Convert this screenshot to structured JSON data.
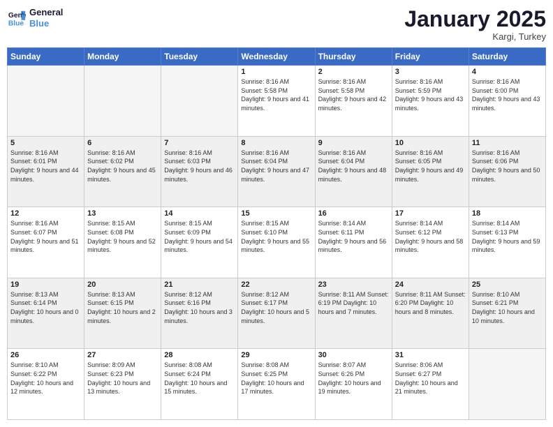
{
  "header": {
    "logo_line1": "General",
    "logo_line2": "Blue",
    "month": "January 2025",
    "location": "Kargi, Turkey"
  },
  "days_of_week": [
    "Sunday",
    "Monday",
    "Tuesday",
    "Wednesday",
    "Thursday",
    "Friday",
    "Saturday"
  ],
  "weeks": [
    [
      {
        "day": "",
        "text": ""
      },
      {
        "day": "",
        "text": ""
      },
      {
        "day": "",
        "text": ""
      },
      {
        "day": "1",
        "text": "Sunrise: 8:16 AM\nSunset: 5:58 PM\nDaylight: 9 hours\nand 41 minutes."
      },
      {
        "day": "2",
        "text": "Sunrise: 8:16 AM\nSunset: 5:58 PM\nDaylight: 9 hours\nand 42 minutes."
      },
      {
        "day": "3",
        "text": "Sunrise: 8:16 AM\nSunset: 5:59 PM\nDaylight: 9 hours\nand 43 minutes."
      },
      {
        "day": "4",
        "text": "Sunrise: 8:16 AM\nSunset: 6:00 PM\nDaylight: 9 hours\nand 43 minutes."
      }
    ],
    [
      {
        "day": "5",
        "text": "Sunrise: 8:16 AM\nSunset: 6:01 PM\nDaylight: 9 hours\nand 44 minutes."
      },
      {
        "day": "6",
        "text": "Sunrise: 8:16 AM\nSunset: 6:02 PM\nDaylight: 9 hours\nand 45 minutes."
      },
      {
        "day": "7",
        "text": "Sunrise: 8:16 AM\nSunset: 6:03 PM\nDaylight: 9 hours\nand 46 minutes."
      },
      {
        "day": "8",
        "text": "Sunrise: 8:16 AM\nSunset: 6:04 PM\nDaylight: 9 hours\nand 47 minutes."
      },
      {
        "day": "9",
        "text": "Sunrise: 8:16 AM\nSunset: 6:04 PM\nDaylight: 9 hours\nand 48 minutes."
      },
      {
        "day": "10",
        "text": "Sunrise: 8:16 AM\nSunset: 6:05 PM\nDaylight: 9 hours\nand 49 minutes."
      },
      {
        "day": "11",
        "text": "Sunrise: 8:16 AM\nSunset: 6:06 PM\nDaylight: 9 hours\nand 50 minutes."
      }
    ],
    [
      {
        "day": "12",
        "text": "Sunrise: 8:16 AM\nSunset: 6:07 PM\nDaylight: 9 hours\nand 51 minutes."
      },
      {
        "day": "13",
        "text": "Sunrise: 8:15 AM\nSunset: 6:08 PM\nDaylight: 9 hours\nand 52 minutes."
      },
      {
        "day": "14",
        "text": "Sunrise: 8:15 AM\nSunset: 6:09 PM\nDaylight: 9 hours\nand 54 minutes."
      },
      {
        "day": "15",
        "text": "Sunrise: 8:15 AM\nSunset: 6:10 PM\nDaylight: 9 hours\nand 55 minutes."
      },
      {
        "day": "16",
        "text": "Sunrise: 8:14 AM\nSunset: 6:11 PM\nDaylight: 9 hours\nand 56 minutes."
      },
      {
        "day": "17",
        "text": "Sunrise: 8:14 AM\nSunset: 6:12 PM\nDaylight: 9 hours\nand 58 minutes."
      },
      {
        "day": "18",
        "text": "Sunrise: 8:14 AM\nSunset: 6:13 PM\nDaylight: 9 hours\nand 59 minutes."
      }
    ],
    [
      {
        "day": "19",
        "text": "Sunrise: 8:13 AM\nSunset: 6:14 PM\nDaylight: 10 hours\nand 0 minutes."
      },
      {
        "day": "20",
        "text": "Sunrise: 8:13 AM\nSunset: 6:15 PM\nDaylight: 10 hours\nand 2 minutes."
      },
      {
        "day": "21",
        "text": "Sunrise: 8:12 AM\nSunset: 6:16 PM\nDaylight: 10 hours\nand 3 minutes."
      },
      {
        "day": "22",
        "text": "Sunrise: 8:12 AM\nSunset: 6:17 PM\nDaylight: 10 hours\nand 5 minutes."
      },
      {
        "day": "23",
        "text": "Sunrise: 8:11 AM\nSunset: 6:19 PM\nDaylight: 10 hours\nand 7 minutes."
      },
      {
        "day": "24",
        "text": "Sunrise: 8:11 AM\nSunset: 6:20 PM\nDaylight: 10 hours\nand 8 minutes."
      },
      {
        "day": "25",
        "text": "Sunrise: 8:10 AM\nSunset: 6:21 PM\nDaylight: 10 hours\nand 10 minutes."
      }
    ],
    [
      {
        "day": "26",
        "text": "Sunrise: 8:10 AM\nSunset: 6:22 PM\nDaylight: 10 hours\nand 12 minutes."
      },
      {
        "day": "27",
        "text": "Sunrise: 8:09 AM\nSunset: 6:23 PM\nDaylight: 10 hours\nand 13 minutes."
      },
      {
        "day": "28",
        "text": "Sunrise: 8:08 AM\nSunset: 6:24 PM\nDaylight: 10 hours\nand 15 minutes."
      },
      {
        "day": "29",
        "text": "Sunrise: 8:08 AM\nSunset: 6:25 PM\nDaylight: 10 hours\nand 17 minutes."
      },
      {
        "day": "30",
        "text": "Sunrise: 8:07 AM\nSunset: 6:26 PM\nDaylight: 10 hours\nand 19 minutes."
      },
      {
        "day": "31",
        "text": "Sunrise: 8:06 AM\nSunset: 6:27 PM\nDaylight: 10 hours\nand 21 minutes."
      },
      {
        "day": "",
        "text": ""
      }
    ]
  ]
}
